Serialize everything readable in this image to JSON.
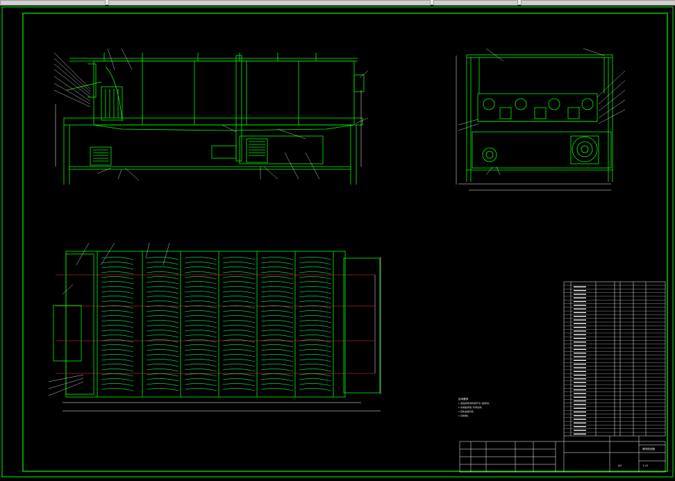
{
  "colors": {
    "background": "#000000",
    "outline": "#00ff00",
    "centerline": "#ff3b3b",
    "dimension": "#ffffff",
    "device": "#00ff66",
    "ui_chrome": "#e8e8e8"
  },
  "icons": {
    "balloon": "leader-callout",
    "motor": "motor-block",
    "fan": "circular-fan-housing"
  },
  "views": {
    "front": {
      "name": "front-elevation"
    },
    "side": {
      "name": "side-elevation"
    },
    "plan": {
      "name": "plan-view"
    }
  },
  "notes": {
    "title": "技术要求",
    "lines": [
      "1. 装配前所有零件清洗干净, 去除毛刺。",
      "2. 各焊缝应牢固, 不得有虚焊。",
      "3. 链传动运转平稳。",
      "4. 涂防锈漆。"
    ]
  },
  "title_block": {
    "drawing_name": "清洗机总图",
    "scale": "1:10",
    "sheet_code": "A0"
  }
}
